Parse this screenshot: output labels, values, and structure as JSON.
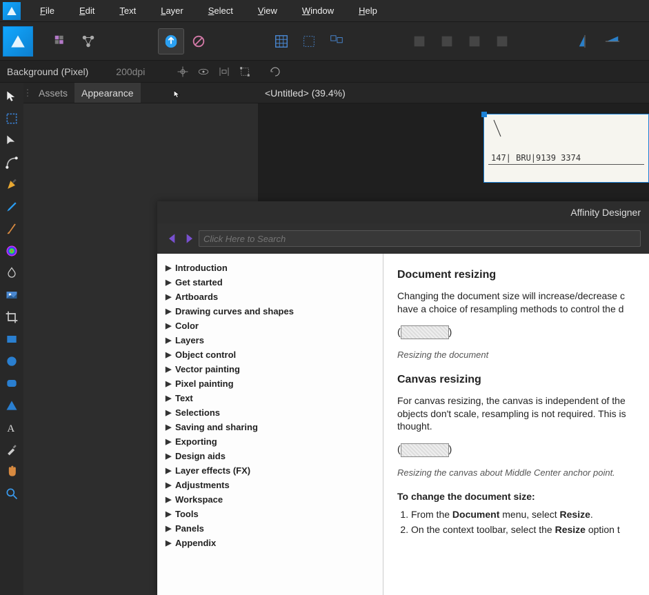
{
  "menubar": {
    "items": [
      {
        "label": "File",
        "hot": "F"
      },
      {
        "label": "Edit",
        "hot": "E"
      },
      {
        "label": "Text",
        "hot": "T"
      },
      {
        "label": "Layer",
        "hot": "L"
      },
      {
        "label": "Select",
        "hot": "S"
      },
      {
        "label": "View",
        "hot": "V"
      },
      {
        "label": "Window",
        "hot": "W"
      },
      {
        "label": "Help",
        "hot": "H"
      }
    ]
  },
  "contextbar": {
    "layer_label": "Background (Pixel)",
    "dpi": "200dpi"
  },
  "panels": {
    "tabs": [
      {
        "label": "Assets"
      },
      {
        "label": "Appearance"
      }
    ],
    "active_index": 1
  },
  "canvas": {
    "tab_label": "<Untitled> (39.4%)",
    "document_text": "147| BRU|9139 3374"
  },
  "help": {
    "app_title": "Affinity Designer",
    "search_placeholder": "Click Here to Search",
    "toc": [
      "Introduction",
      "Get started",
      "Artboards",
      "Drawing curves and shapes",
      "Color",
      "Layers",
      "Object control",
      "Vector painting",
      "Pixel painting",
      "Text",
      "Selections",
      "Saving and sharing",
      "Exporting",
      "Design aids",
      "Layer effects (FX)",
      "Adjustments",
      "Workspace",
      "Tools",
      "Panels",
      "Appendix"
    ],
    "content": {
      "h_doc": "Document resizing",
      "p_doc": "Changing the document size will increase/decrease c have a choice of resampling methods to control the d",
      "cap_doc": "Resizing the document",
      "h_canvas": "Canvas resizing",
      "p_canvas": "For canvas resizing, the canvas is independent of the objects don't scale, resampling is not required. This is thought.",
      "cap_canvas": "Resizing the canvas about Middle Center anchor point.",
      "h_steps": "To change the document size:",
      "step1_a": "From the ",
      "step1_b": "Document",
      "step1_c": " menu, select ",
      "step1_d": "Resize",
      "step1_e": ".",
      "step2_a": "On the context toolbar, select the ",
      "step2_b": "Resize",
      "step2_c": " option t"
    }
  },
  "tools_col": [
    "move-tool",
    "artboard-tool",
    "node-tool",
    "corner-tool",
    "pen-tool",
    "pencil-tool",
    "brush-tool",
    "fill-tool",
    "transparency-tool",
    "place-tool",
    "crop-tool",
    "rectangle-tool",
    "ellipse-tool",
    "round-rect-tool",
    "triangle-tool",
    "text-tool",
    "eyedropper-tool",
    "hand-tool",
    "zoom-tool"
  ]
}
